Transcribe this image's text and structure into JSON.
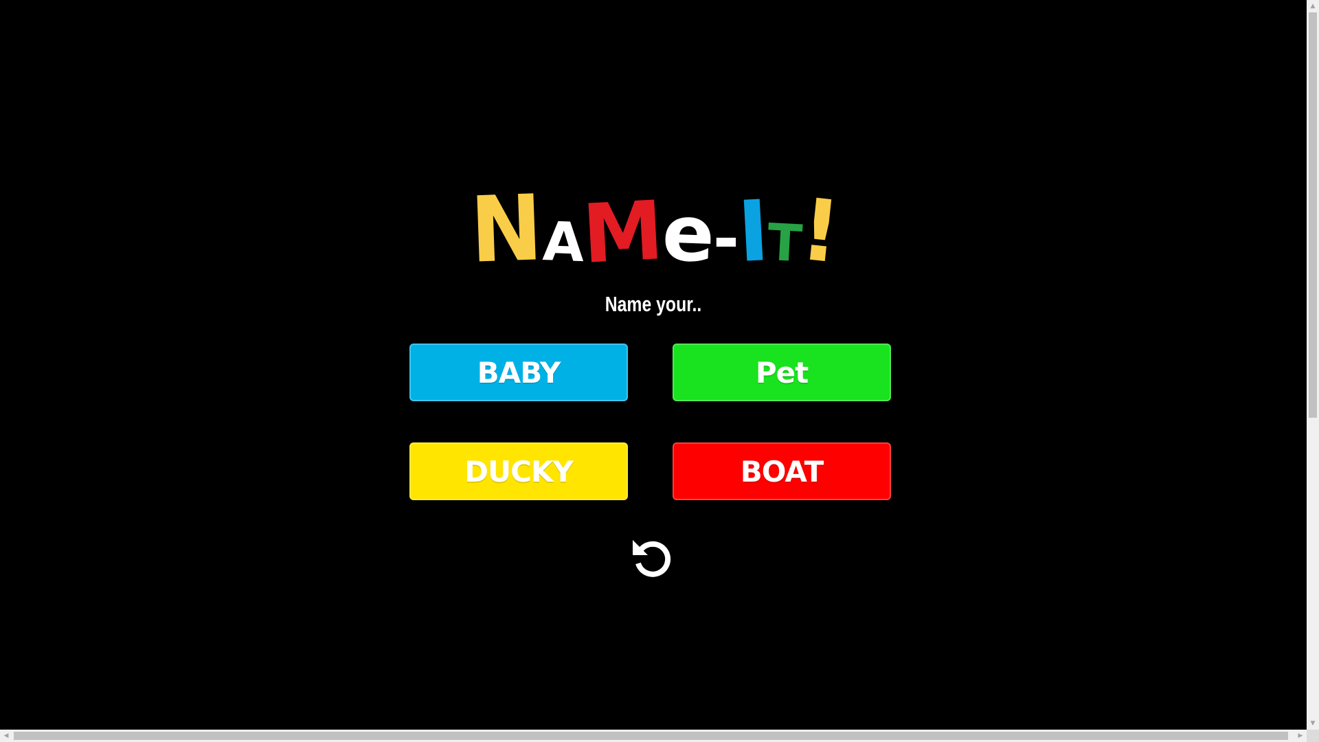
{
  "title": {
    "letters": [
      {
        "char": "N",
        "color": "#F9CD48"
      },
      {
        "char": "A",
        "color": "#FFFFFF"
      },
      {
        "char": "M",
        "color": "#E31B23"
      },
      {
        "char": "e",
        "color": "#FFFFFF"
      },
      {
        "char": "-",
        "color": "#FFFFFF"
      },
      {
        "char": "I",
        "color": "#0BA2E1"
      },
      {
        "char": "T",
        "color": "#27A345"
      },
      {
        "char": "!",
        "color": "#F9CD48"
      }
    ]
  },
  "subtitle": "Name your..",
  "choices": [
    {
      "label": "BABY",
      "color": "#00B1E6"
    },
    {
      "label": "Pet",
      "color": "#19E21E"
    },
    {
      "label": "DUCKY",
      "color": "#FFE500"
    },
    {
      "label": "BOAT",
      "color": "#FF0000"
    }
  ],
  "icons": {
    "refresh": "refresh-icon"
  },
  "scrollbars": {
    "up": "▲",
    "down": "▼",
    "left": "◀",
    "right": "▶"
  }
}
